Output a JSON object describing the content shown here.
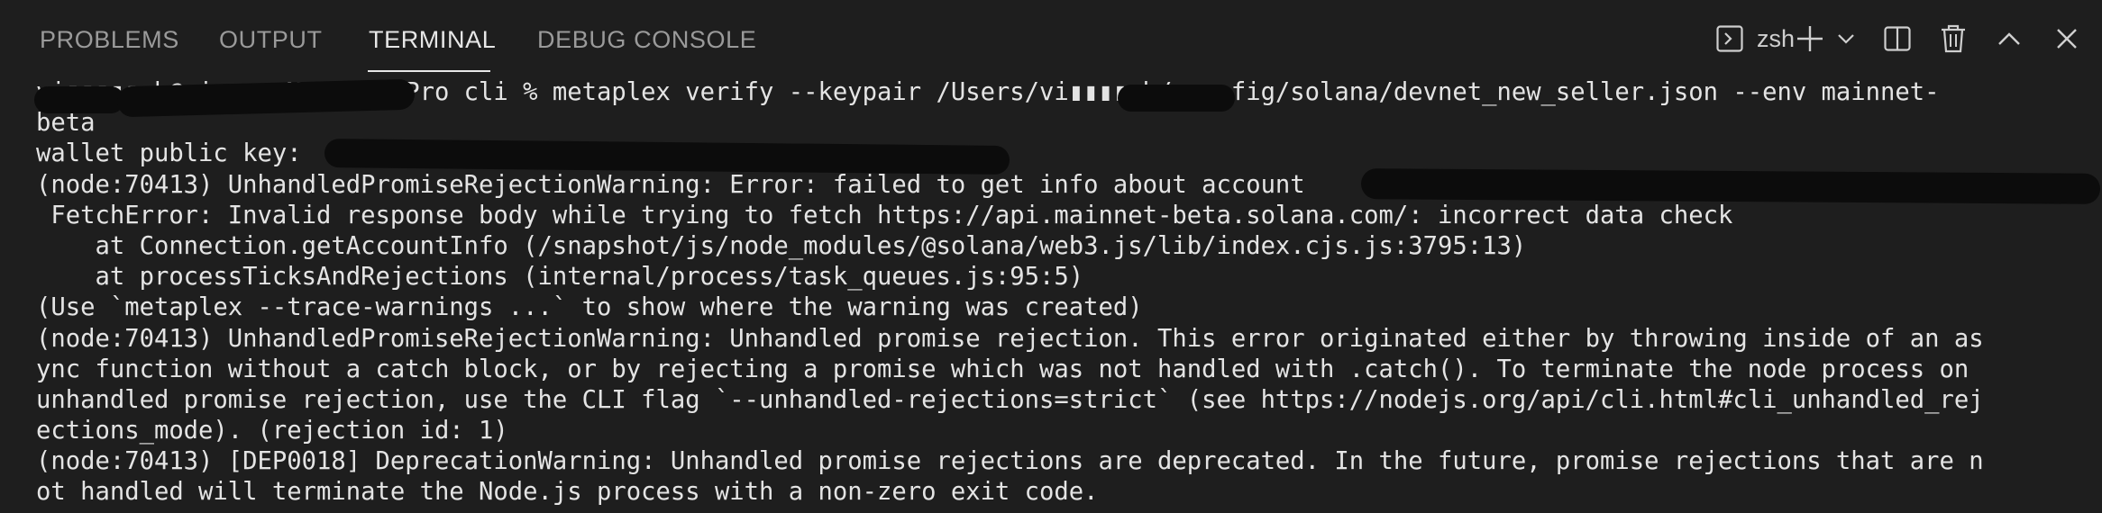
{
  "tabs": [
    {
      "label": "PROBLEMS",
      "active": false
    },
    {
      "label": "OUTPUT",
      "active": false
    },
    {
      "label": "TERMINAL",
      "active": true
    },
    {
      "label": "DEBUG CONSOLE",
      "active": false
    }
  ],
  "toolbar": {
    "shell_name": "zsh",
    "icons": [
      "terminal-icon",
      "plus-icon",
      "chevron-down-icon",
      "split-icon",
      "trash-icon",
      "chevron-up-icon",
      "close-icon"
    ]
  },
  "terminal": {
    "lines": [
      "vi▮▮▮▮▮gh@vi▮▮▮▮▮MacBook-Pro cli % metaplex verify --keypair /Users/vi▮▮▮▮▮h/.config/solana/devnet_new_seller.json --env mainnet-",
      "beta",
      "wallet public key: ",
      "(node:70413) UnhandledPromiseRejectionWarning: Error: failed to get info about account ",
      " FetchError: Invalid response body while trying to fetch https://api.mainnet-beta.solana.com/: incorrect data check",
      "    at Connection.getAccountInfo (/snapshot/js/node_modules/@solana/web3.js/lib/index.cjs.js:3795:13)",
      "    at processTicksAndRejections (internal/process/task_queues.js:95:5)",
      "(Use `metaplex --trace-warnings ...` to show where the warning was created)",
      "(node:70413) UnhandledPromiseRejectionWarning: Unhandled promise rejection. This error originated either by throwing inside of an as",
      "ync function without a catch block, or by rejecting a promise which was not handled with .catch(). To terminate the node process on",
      "unhandled promise rejection, use the CLI flag `--unhandled-rejections=strict` (see https://nodejs.org/api/cli.html#cli_unhandled_rej",
      "ections_mode). (rejection id: 1)",
      "(node:70413) [DEP0018] DeprecationWarning: Unhandled promise rejections are deprecated. In the future, promise rejections that are n",
      "ot handled will terminate the Node.js process with a non-zero exit code."
    ]
  }
}
